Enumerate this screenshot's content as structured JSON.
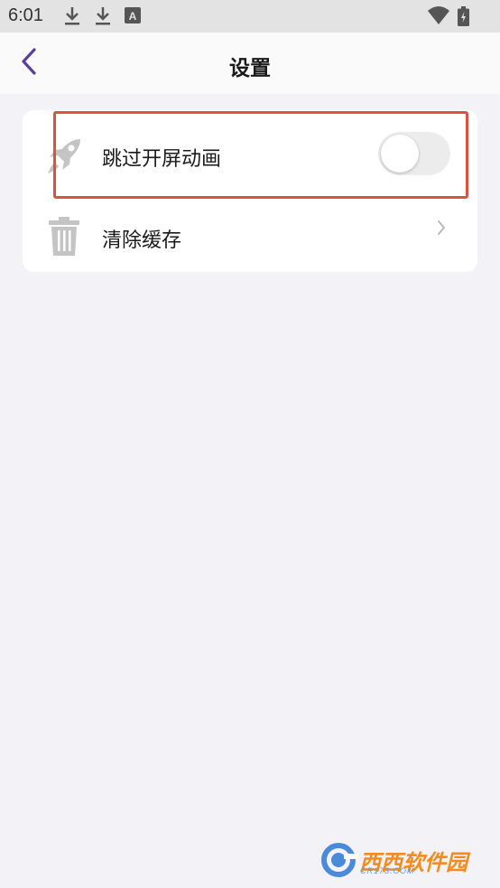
{
  "status_bar": {
    "time": "6:01",
    "icons": [
      "download-icon",
      "download-icon",
      "a-box-icon",
      "wifi-icon",
      "battery-icon"
    ]
  },
  "nav": {
    "title": "设置",
    "back_icon": "chevron-left-icon",
    "accent_color": "#5b3f9a"
  },
  "settings": {
    "items": [
      {
        "icon": "rocket-icon",
        "label": "跳过开屏动画",
        "control": "toggle",
        "toggle_on": false
      },
      {
        "icon": "trash-icon",
        "label": "清除缓存",
        "control": "chevron-right-icon"
      }
    ]
  },
  "highlight": {
    "color": "#d7553f"
  },
  "watermark": {
    "brand": "西西软件园",
    "url": "CR173.COM"
  }
}
